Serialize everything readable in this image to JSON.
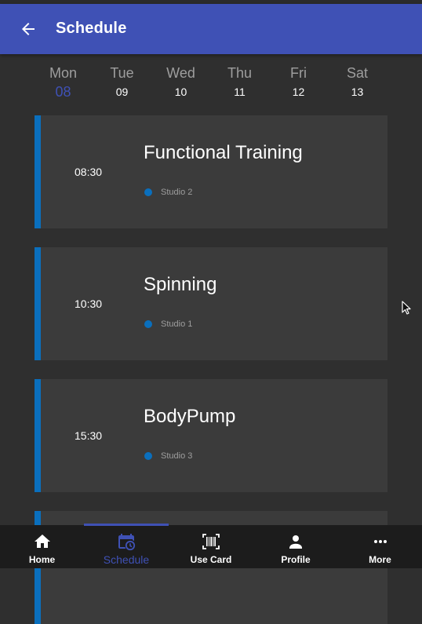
{
  "appbar": {
    "title": "Schedule",
    "back_icon": "arrow-back-icon"
  },
  "days": [
    {
      "name": "Mon",
      "num": "08",
      "selected": true
    },
    {
      "name": "Tue",
      "num": "09",
      "selected": false
    },
    {
      "name": "Wed",
      "num": "10",
      "selected": false
    },
    {
      "name": "Thu",
      "num": "11",
      "selected": false
    },
    {
      "name": "Fri",
      "num": "12",
      "selected": false
    },
    {
      "name": "Sat",
      "num": "13",
      "selected": false
    }
  ],
  "classes": [
    {
      "time": "08:30",
      "title": "Functional Training",
      "location": "Studio 2"
    },
    {
      "time": "10:30",
      "title": "Spinning",
      "location": "Studio 1"
    },
    {
      "time": "15:30",
      "title": "BodyPump",
      "location": "Studio 3"
    }
  ],
  "bottom_nav": [
    {
      "label": "Home",
      "icon": "home-icon",
      "active": false
    },
    {
      "label": "Schedule",
      "icon": "calendar-icon",
      "active": true
    },
    {
      "label": "Use Card",
      "icon": "barcode-icon",
      "active": false
    },
    {
      "label": "Profile",
      "icon": "person-icon",
      "active": false
    },
    {
      "label": "More",
      "icon": "more-horiz-icon",
      "active": false
    }
  ],
  "colors": {
    "primary": "#3f51b5",
    "accent_blue": "#0a6fbd",
    "background": "#2f2f2f",
    "card": "#3b3b3b",
    "bottom_nav": "#1c1c1c"
  }
}
